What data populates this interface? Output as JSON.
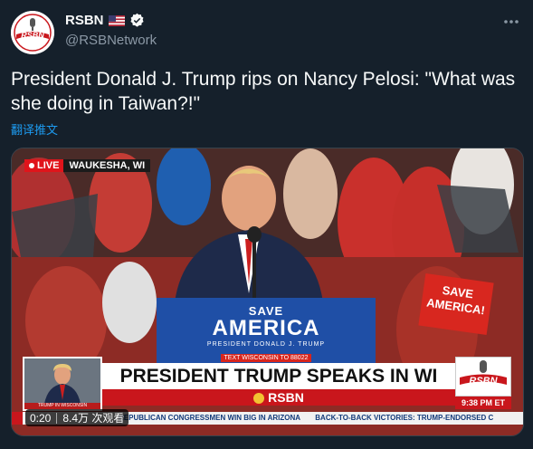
{
  "account": {
    "display_name": "RSBN",
    "handle": "@RSBNetwork",
    "avatar_text": "RSBN"
  },
  "tweet": {
    "text": "President Donald J. Trump rips on Nancy Pelosi: \"What was she doing in Taiwan?!\"",
    "translate_label": "翻译推文"
  },
  "video": {
    "live_label": "LIVE",
    "location": "WAUKESHA, WI",
    "podium_sign": {
      "top": "SAVE",
      "main": "AMERICA",
      "sub": "PRESIDENT DONALD J. TRUMP",
      "text_line": "TEXT WISCONSIN TO 88022"
    },
    "crowd_sign": "SAVE AMERICA!",
    "thumb_label": "TRUMP IN WISCONSIN",
    "headline": "PRESIDENT TRUMP SPEAKS IN WI",
    "brand": "RSBN",
    "logo_text": "RSBN",
    "time": "9:38 PM ET",
    "ticker": [
      "REPUBLICAN CONGRESSMEN WIN BIG IN ARIZONA",
      "BACK-TO-BACK VICTORIES: TRUMP-ENDORSED C"
    ],
    "elapsed": "0:20",
    "views": "8.4万 次观看"
  },
  "colors": {
    "background": "#15202b",
    "link": "#1d9bf0",
    "secondary_text": "#8b98a5",
    "rsbn_red": "#c9161c",
    "sign_blue": "#1f4fa6"
  }
}
